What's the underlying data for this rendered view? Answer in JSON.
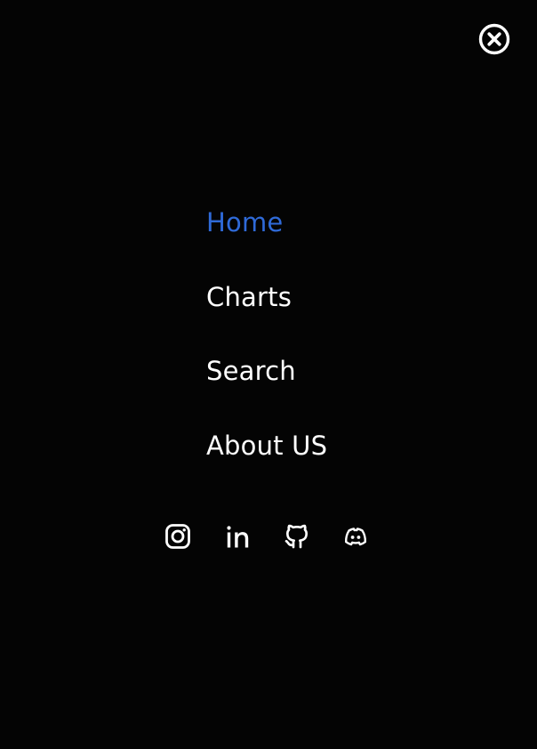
{
  "menu": {
    "items": [
      {
        "label": "Home",
        "active": true
      },
      {
        "label": "Charts",
        "active": false
      },
      {
        "label": "Search",
        "active": false
      },
      {
        "label": "About US",
        "active": false
      }
    ]
  },
  "icons": {
    "close": "close-circle-icon",
    "socials": [
      "instagram-icon",
      "linkedin-icon",
      "github-icon",
      "discord-icon"
    ]
  },
  "colors": {
    "background": "#040404",
    "text": "#ffffff",
    "active": "#2f6ad8"
  }
}
